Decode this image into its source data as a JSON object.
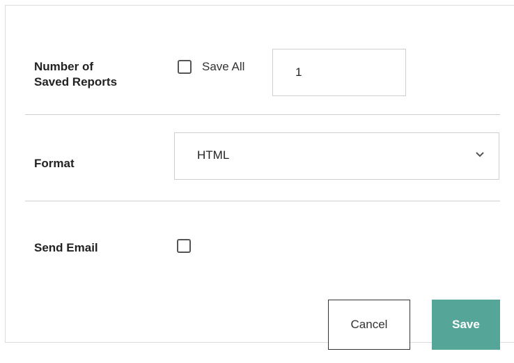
{
  "form": {
    "saved_reports": {
      "label_line1": "Number of",
      "label_line2": "Saved Reports",
      "save_all_label": "Save All",
      "save_all_checked": false,
      "count_value": "1"
    },
    "format": {
      "label": "Format",
      "selected": "HTML"
    },
    "send_email": {
      "label": "Send Email",
      "checked": false
    }
  },
  "actions": {
    "cancel_label": "Cancel",
    "save_label": "Save"
  },
  "icons": {
    "format_dropdown": "chevron-down-icon"
  },
  "colors": {
    "save_button": "#55a698",
    "divider": "#cfcfcf",
    "border": "#dcdcdc"
  }
}
